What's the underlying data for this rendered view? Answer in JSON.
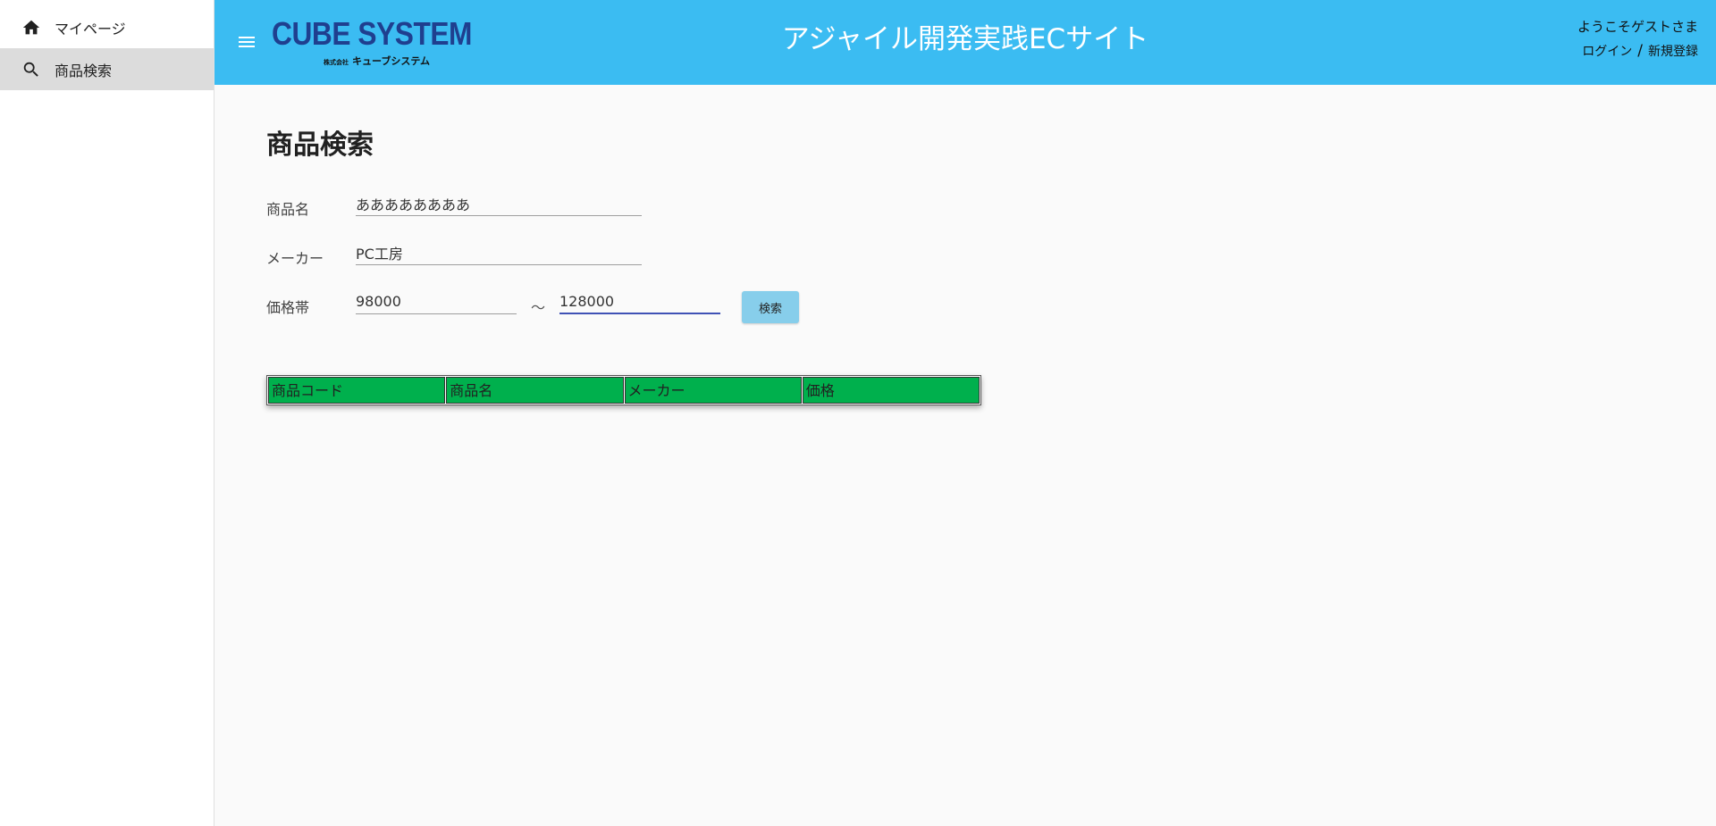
{
  "sidebar": {
    "items": [
      {
        "label": "マイページ",
        "icon": "home-icon"
      },
      {
        "label": "商品検索",
        "icon": "search-icon",
        "active": true
      }
    ]
  },
  "header": {
    "logo_text": "CUBE SYSTEM",
    "logo_sub_small": "株式会社",
    "logo_sub": "キューブシステム",
    "site_title": "アジャイル開発実践ECサイト",
    "welcome": "ようこそゲストさま",
    "login": "ログイン",
    "separator": "/",
    "register": "新規登録",
    "bg_color": "#3bbcf2"
  },
  "main": {
    "page_title": "商品検索",
    "form": {
      "name_label": "商品名",
      "name_value": "ああああああああ",
      "maker_label": "メーカー",
      "maker_value": "PC工房",
      "price_label": "価格帯",
      "price_min": "98000",
      "tilde": "～",
      "price_max": "128000",
      "search_button": "検索"
    },
    "table": {
      "headers": [
        "商品コード",
        "商品名",
        "メーカー",
        "価格"
      ],
      "header_color": "#00b04d"
    }
  }
}
